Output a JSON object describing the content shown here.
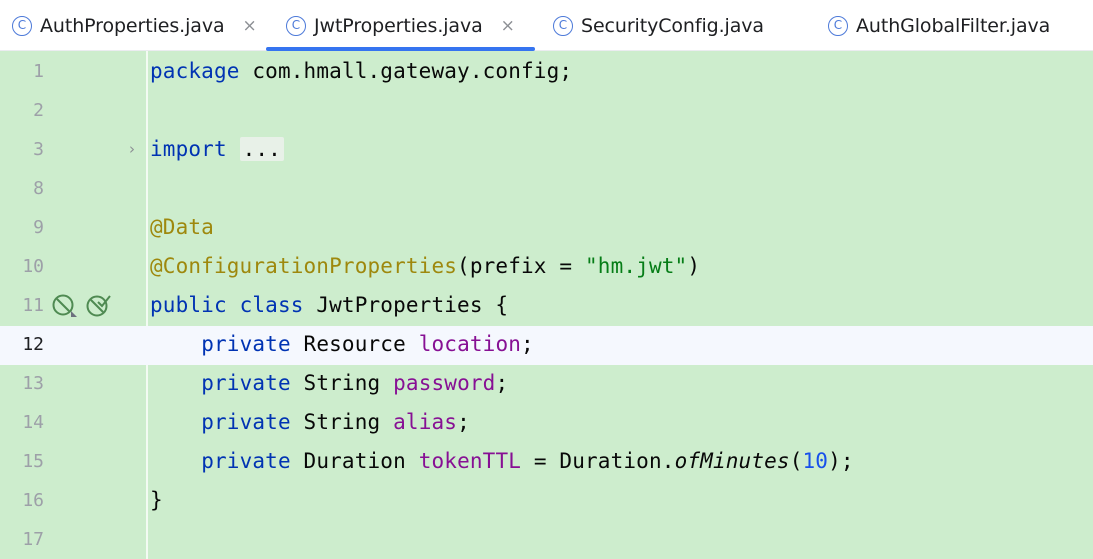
{
  "tabs": [
    {
      "name": "AuthProperties.java",
      "icon": "class-icon",
      "icon_glyph": "C",
      "close": "×",
      "active": false
    },
    {
      "name": "JwtProperties.java",
      "icon": "class-icon",
      "icon_glyph": "C",
      "close": "×",
      "active": true
    },
    {
      "name": "SecurityConfig.java",
      "icon": "class-icon",
      "icon_glyph": "C",
      "close": "",
      "active": false
    },
    {
      "name": "AuthGlobalFilter.java",
      "icon": "class-icon",
      "icon_glyph": "C",
      "close": "",
      "active": false
    }
  ],
  "editor": {
    "current_line": "12",
    "line_numbers": [
      "1",
      "2",
      "3",
      "8",
      "9",
      "10",
      "11",
      "12",
      "13",
      "14",
      "15",
      "16",
      "17"
    ],
    "fold_arrow": "›",
    "code": {
      "l1_kw": "package",
      "l1_rest": " com.hmall.gateway.config;",
      "l3_kw": "import",
      "l3_dots": "...",
      "l9_ann": "@Data",
      "l10_ann": "@ConfigurationProperties",
      "l10_open": "(prefix = ",
      "l10_str": "\"hm.jwt\"",
      "l10_close": ")",
      "l11_kw1": "public",
      "l11_kw2": "class",
      "l11_rest": " JwtProperties {",
      "l12_kw": "private",
      "l12_type": " Resource ",
      "l12_field": "location",
      "l12_end": ";",
      "l13_kw": "private",
      "l13_type": " String ",
      "l13_field": "password",
      "l13_end": ";",
      "l14_kw": "private",
      "l14_type": " String ",
      "l14_field": "alias",
      "l14_end": ";",
      "l15_kw": "private",
      "l15_type": " Duration ",
      "l15_field": "tokenTTL",
      "l15_mid": " = Duration.",
      "l15_method": "ofMinutes",
      "l15_open": "(",
      "l15_num": "10",
      "l15_close": ");",
      "l16_brace": "}"
    },
    "gutter_icons": [
      "bean-disabled-icon",
      "bean-check-icon"
    ]
  }
}
